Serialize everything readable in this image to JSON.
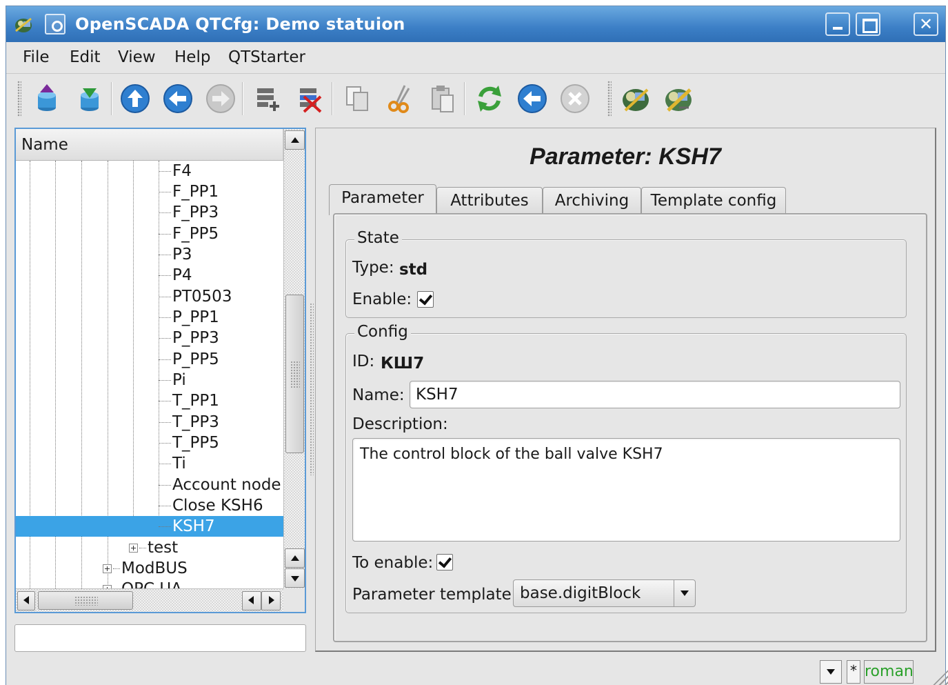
{
  "window": {
    "title": "OpenSCADA QTCfg: Demo statuion",
    "close_glyph": "✕"
  },
  "menu": {
    "file": "File",
    "edit": "Edit",
    "view": "View",
    "help": "Help",
    "qtstarter": "QTStarter"
  },
  "toolbar": {
    "icons": [
      "db-load-icon",
      "db-save-icon",
      "up-icon",
      "back-icon",
      "forward-icon",
      "add-item-icon",
      "delete-item-icon",
      "copy-icon",
      "cut-icon",
      "paste-icon",
      "refresh-icon",
      "start-icon",
      "stop-icon",
      "openscada-icon",
      "openscada-config-icon"
    ]
  },
  "tree": {
    "header": "Name",
    "items": [
      "F4",
      "F_PP1",
      "F_PP3",
      "F_PP5",
      "P3",
      "P4",
      "PT0503",
      "P_PP1",
      "P_PP3",
      "P_PP5",
      "Pi",
      "T_PP1",
      "T_PP3",
      "T_PP5",
      "Ti",
      "Account node",
      "Close KSH6",
      "KSH7"
    ],
    "selected": "KSH7",
    "collapsed": [
      "test",
      "ModBUS",
      "OPC UA"
    ]
  },
  "panel": {
    "title": "Parameter: KSH7",
    "tabs": [
      "Parameter",
      "Attributes",
      "Archiving",
      "Template config"
    ],
    "active_tab": "Parameter",
    "state": {
      "group_title": "State",
      "type_label": "Type:",
      "type_value": "std",
      "enable_label": "Enable:",
      "enable_checked": true
    },
    "config": {
      "group_title": "Config",
      "id_label": "ID:",
      "id_value": "КШ7",
      "name_label": "Name:",
      "name_value": "KSH7",
      "description_label": "Description:",
      "description_value": "The control block of the ball valve KSH7",
      "to_enable_label": "To enable:",
      "to_enable_checked": true,
      "template_label": "Parameter template:",
      "template_value": "base.digitBlock"
    }
  },
  "status": {
    "star": "*",
    "user": "roman"
  },
  "colors": {
    "title_bar": "#3c7fc6",
    "selection": "#3ba3e6",
    "user_text": "#2aa02a"
  }
}
